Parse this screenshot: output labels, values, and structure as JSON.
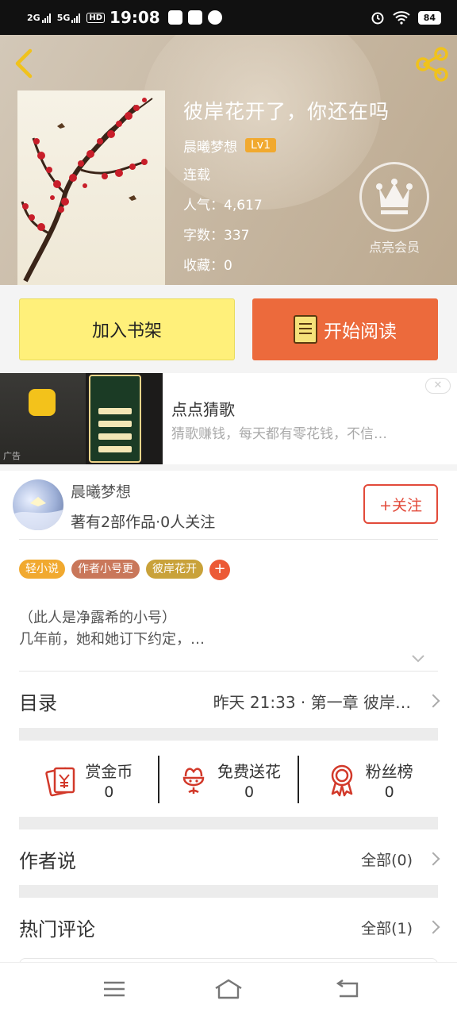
{
  "status_bar": {
    "net1": "2G",
    "net2": "5G",
    "hd": "HD",
    "time": "19:08",
    "battery": "84"
  },
  "book": {
    "title": "彼岸花开了，你还在吗",
    "author": "晨曦梦想",
    "level": "Lv1",
    "status": "连载",
    "popularity": "人气：4,617",
    "word_count": "字数：337",
    "favorites": "收藏：0"
  },
  "vip": {
    "label": "点亮会员"
  },
  "actions": {
    "add_shelf": "加入书架",
    "start_read": "开始阅读"
  },
  "ad": {
    "title": "点点猜歌",
    "description": "猜歌赚钱，每天都有零花钱，不信…",
    "tag": "广告",
    "close": "✕"
  },
  "author_card": {
    "name": "晨曦梦想",
    "stats": "著有2部作品·0人关注",
    "follow": "+关注"
  },
  "tags": [
    {
      "label": "轻小说",
      "color": "#f1a92f"
    },
    {
      "label": "作者小号更",
      "color": "#c9775a"
    },
    {
      "label": "彼岸花开",
      "color": "#c9a23a"
    }
  ],
  "tag_plus": "+",
  "description": {
    "line1": "（此人是净露希的小号）",
    "line2": "几年前，她和她订下约定，…"
  },
  "toc": {
    "label": "目录",
    "latest": "昨天 21:33 · 第一章 彼岸…"
  },
  "stats": [
    {
      "name": "赏金币",
      "value": "0",
      "icon": "coin-envelope-icon"
    },
    {
      "name": "免费送花",
      "value": "0",
      "icon": "flower-icon"
    },
    {
      "name": "粉丝榜",
      "value": "0",
      "icon": "medal-icon"
    }
  ],
  "author_says": {
    "label": "作者说",
    "all": "全部(0)"
  },
  "hot_comments": {
    "label": "热门评论",
    "all": "全部(1)"
  },
  "colors": {
    "accent_orange": "#ec6a3c",
    "shelf_yellow": "#fff07a",
    "follow_red": "#e24a3a"
  }
}
